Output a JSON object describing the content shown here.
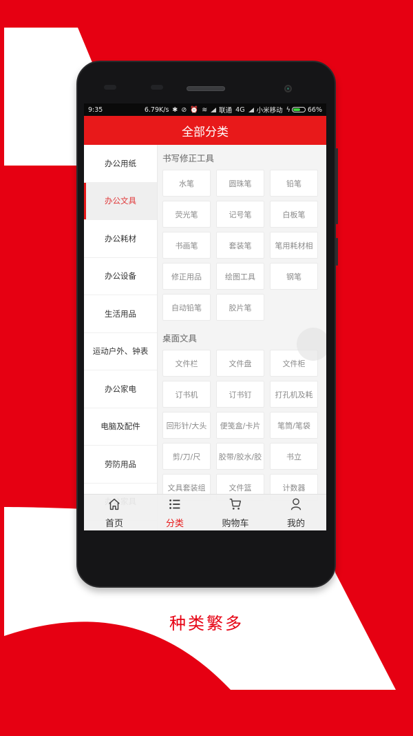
{
  "colors": {
    "brand_red": "#e60012",
    "appbar_red": "#e8191a",
    "active_text": "#e0393a",
    "battery_green": "#3fd13f"
  },
  "statusbar": {
    "time": "9:35",
    "net_speed": "6.79K/s",
    "carrier1": "联通",
    "network": "4G",
    "carrier2": "小米移动",
    "battery_percent": "66%",
    "battery_level": 0.66
  },
  "appbar": {
    "title": "全部分类"
  },
  "sidebar": {
    "active_index": 1,
    "items": [
      {
        "label": "办公用纸"
      },
      {
        "label": "办公文具"
      },
      {
        "label": "办公耗材"
      },
      {
        "label": "办公设备"
      },
      {
        "label": "生活用品"
      },
      {
        "label": "运动户外、钟表"
      },
      {
        "label": "办公家电"
      },
      {
        "label": "电脑及配件"
      },
      {
        "label": "劳防用品"
      },
      {
        "label": "办公家具"
      }
    ]
  },
  "sections": [
    {
      "title": "书写修正工具",
      "items": [
        "水笔",
        "圆珠笔",
        "铅笔",
        "荧光笔",
        "记号笔",
        "白板笔",
        "书画笔",
        "套装笔",
        "笔用耗材相",
        "修正用品",
        "绘图工具",
        "钢笔",
        "自动铅笔",
        "胶片笔"
      ]
    },
    {
      "title": "桌面文具",
      "items": [
        "文件栏",
        "文件盘",
        "文件柜",
        "订书机",
        "订书钉",
        "打孔机及耗",
        "回形针/大头",
        "便笺盒/卡片",
        "笔筒/笔袋",
        "剪/刀/尺",
        "胶带/胶水/胶",
        "书立",
        "文具套装组",
        "文件篮",
        "计数器"
      ]
    }
  ],
  "tabbar": {
    "active_index": 1,
    "tabs": [
      {
        "label": "首页",
        "icon": "home-icon"
      },
      {
        "label": "分类",
        "icon": "list-icon"
      },
      {
        "label": "购物车",
        "icon": "cart-icon"
      },
      {
        "label": "我的",
        "icon": "user-icon"
      }
    ]
  },
  "slogan": "种类繁多"
}
